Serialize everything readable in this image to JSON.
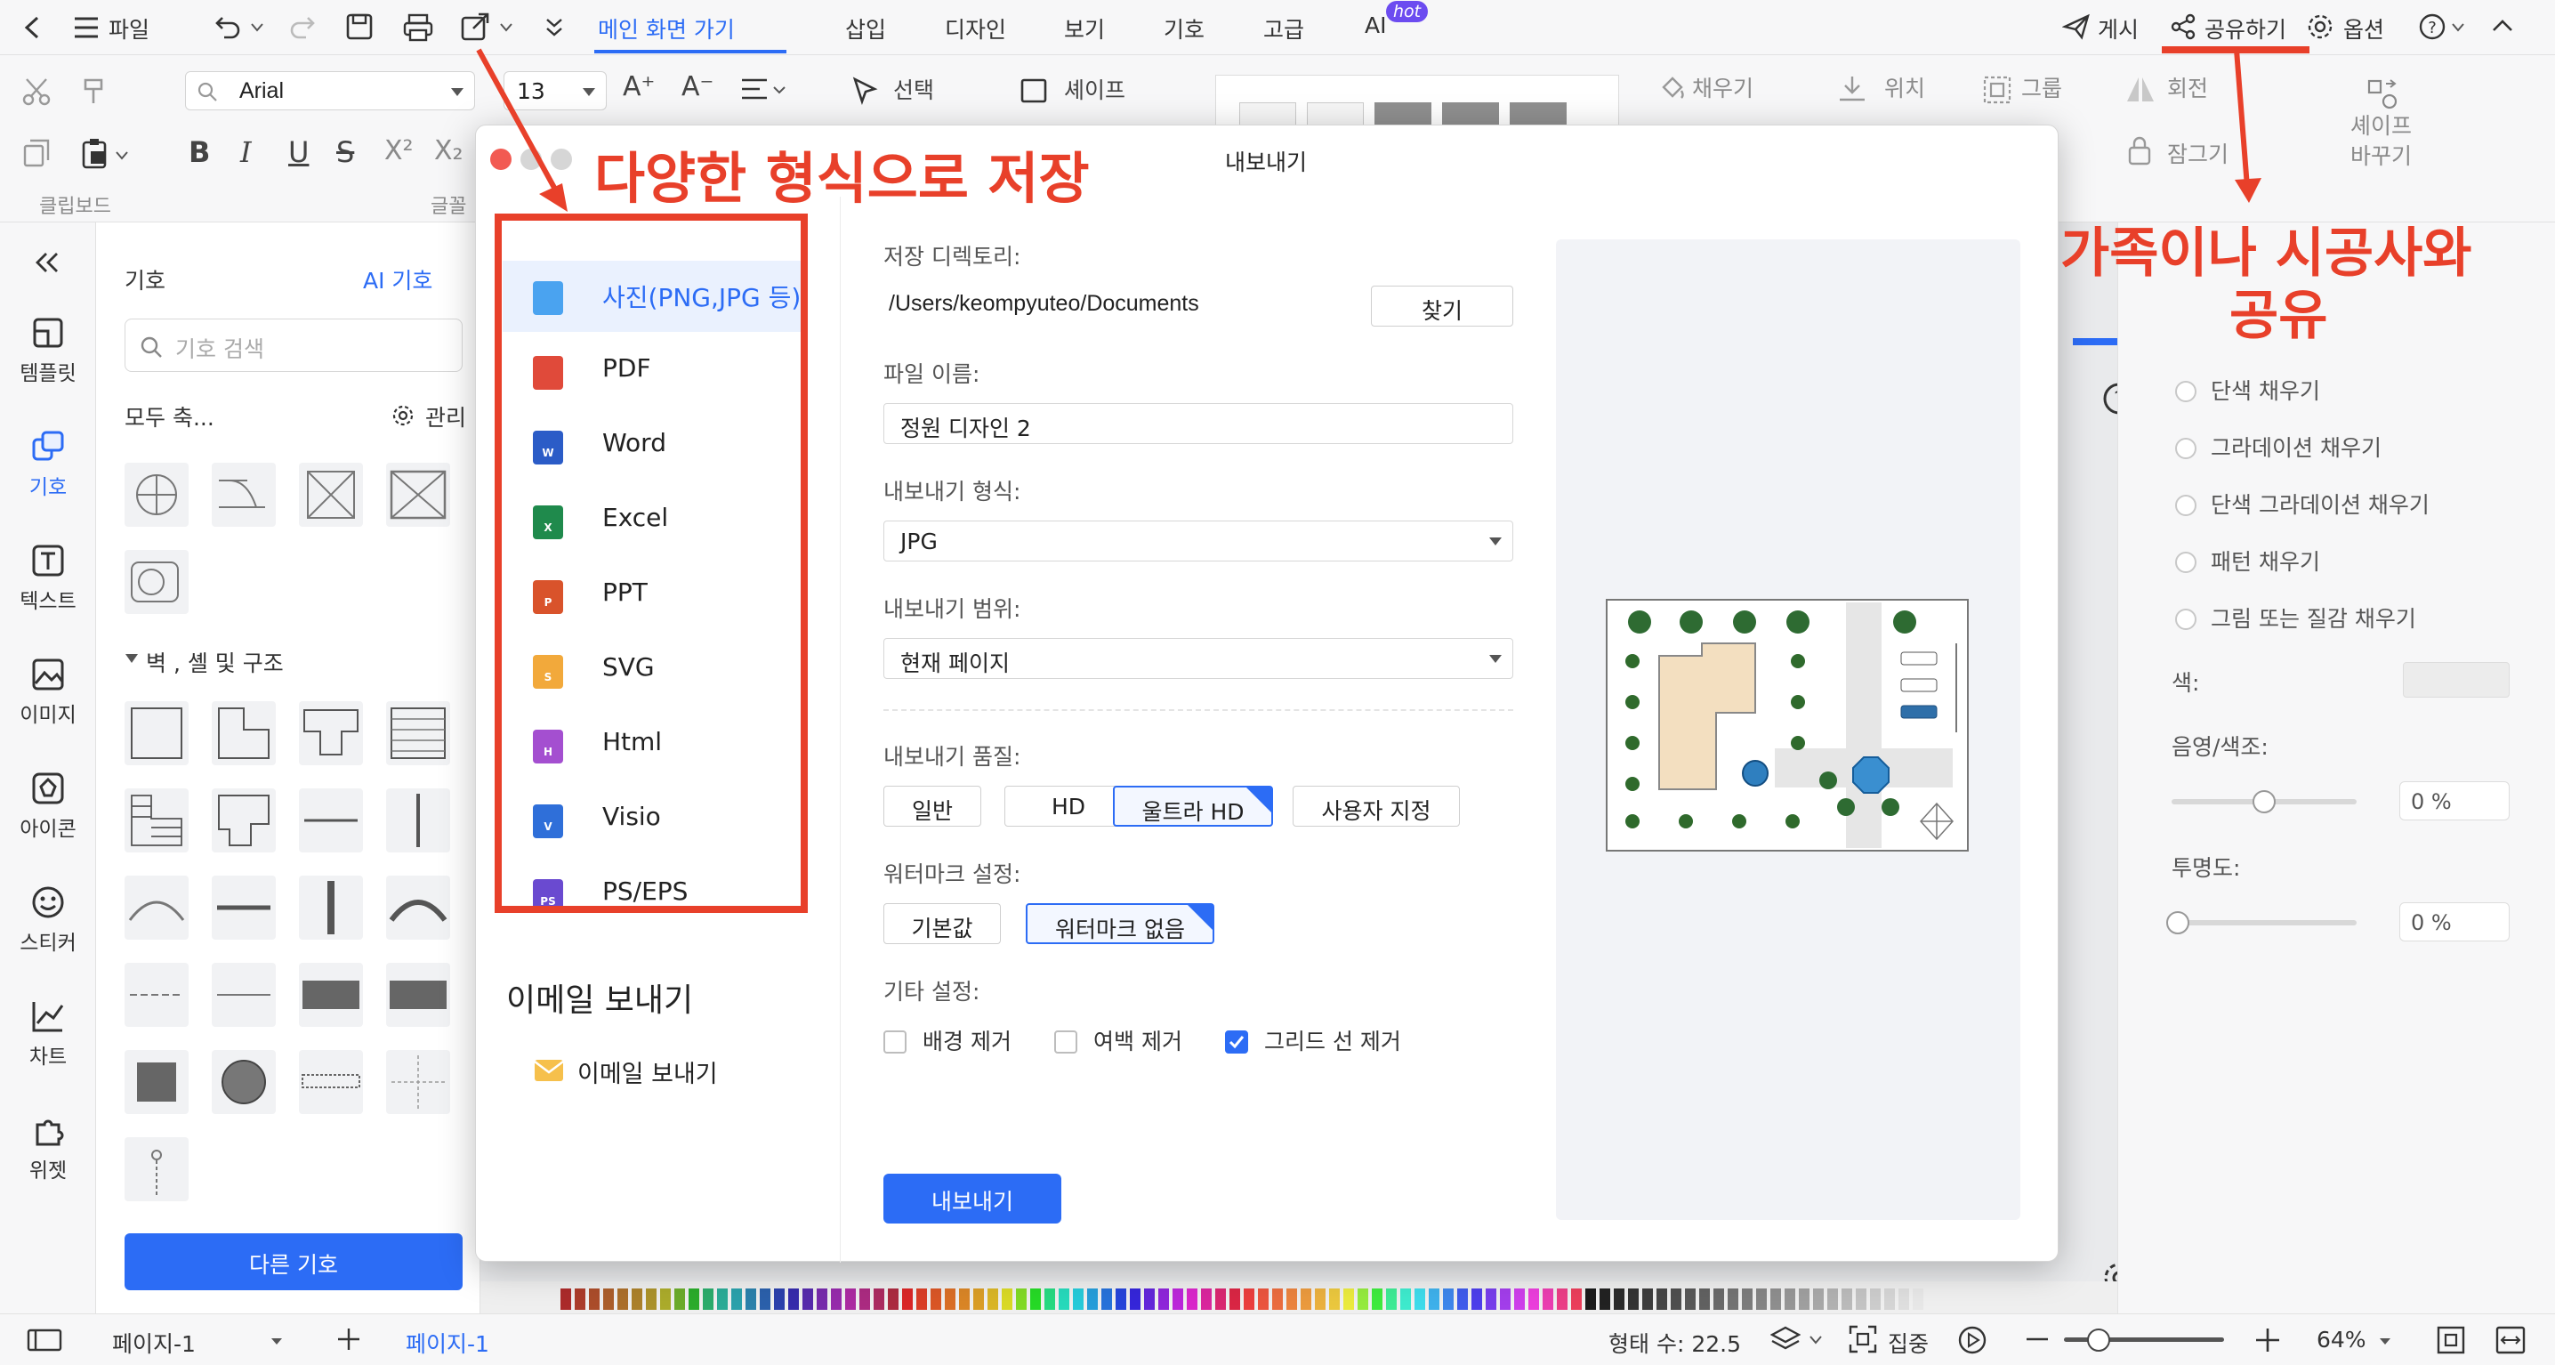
{
  "menubar": {
    "file": "파일",
    "tabs": [
      "메인 화면 가기",
      "삽입",
      "디자인",
      "보기",
      "기호",
      "고급",
      "AI"
    ],
    "hot_badge": "hot",
    "publish": "게시",
    "share": "공유하기",
    "options": "옵션"
  },
  "ribbon": {
    "font_name": "Arial",
    "font_size": "13",
    "select_label": "선택",
    "shape_label": "셰이프",
    "fill_label": "채우기",
    "position_label": "위치",
    "group_label": "그룹",
    "rotate_label": "회전",
    "lock_label": "잠그기",
    "change_shape_label_1": "셰이프",
    "change_shape_label_2": "바꾸기",
    "clipboard_label": "클립보드",
    "font_group_label": "글꼴"
  },
  "rail": {
    "items": [
      "템플릿",
      "기호",
      "텍스트",
      "이미지",
      "아이콘",
      "스티커",
      "차트",
      "위젯"
    ]
  },
  "symbols": {
    "title": "기호",
    "ai_link": "AI 기호",
    "search_placeholder": "기호 검색",
    "collapse_all": "모두 축...",
    "manage": "관리",
    "section_title": "벽 , 셸 및 구조",
    "more_button": "다른 기호"
  },
  "right_panel": {
    "fill_options": [
      "단색 채우기",
      "그라데이션 채우기",
      "단색 그라데이션 채우기",
      "패턴 채우기",
      "그림 또는 질감 채우기"
    ],
    "color_label": "색:",
    "shade_label": "음영/색조:",
    "shade_value": "0 %",
    "shade_level": 0.5,
    "opacity_label": "투명도:",
    "opacity_value": "0 %",
    "opacity_level": 0
  },
  "dialog": {
    "title": "내보내기",
    "formats": [
      "사진(PNG,JPG 등)",
      "PDF",
      "Word",
      "Excel",
      "PPT",
      "SVG",
      "Html",
      "Visio",
      "PS/EPS"
    ],
    "format_colors": [
      "#4aa3f0",
      "#e04a3a",
      "#2b5cc7",
      "#1f8a4c",
      "#d9532b",
      "#f2a93b",
      "#a44fd0",
      "#2f6fd9",
      "#6a4ad0"
    ],
    "format_badges": [
      "",
      "",
      "W",
      "X",
      "P",
      "S",
      "H",
      "V",
      "PS"
    ],
    "email_section": "이메일 보내기",
    "email_item": "이메일 보내기",
    "save_dir_label": "저장 디렉토리:",
    "save_dir_value": "/Users/keompyuteo/Documents",
    "browse_button": "찾기",
    "filename_label": "파일 이름:",
    "filename_value": "정원 디자인 2",
    "format_label": "내보내기 형식:",
    "format_value": "JPG",
    "range_label": "내보내기 범위:",
    "range_value": "현재 페이지",
    "quality_label": "내보내기 품질:",
    "quality_options": [
      "일반",
      "HD",
      "울트라 HD",
      "사용자 지정"
    ],
    "watermark_label": "워터마크 설정:",
    "watermark_options": [
      "기본값",
      "워터마크 없음"
    ],
    "other_label": "기타 설정:",
    "checks": [
      "배경 제거",
      "여백 제거",
      "그리드 선 제거"
    ],
    "export_button": "내보내기"
  },
  "status": {
    "page_select": "페이지-1",
    "page_tab": "페이지-1",
    "shape_count": "형태 수: 22.5",
    "focus": "집중",
    "zoom": "64%"
  },
  "annotations": {
    "formats_note": "다양한 형식으로 저장",
    "share_note_1": "가족이나 시공사와",
    "share_note_2": "공유"
  },
  "colors": {
    "accent": "#2c6cf5",
    "annotation_red": "#e8402a"
  }
}
